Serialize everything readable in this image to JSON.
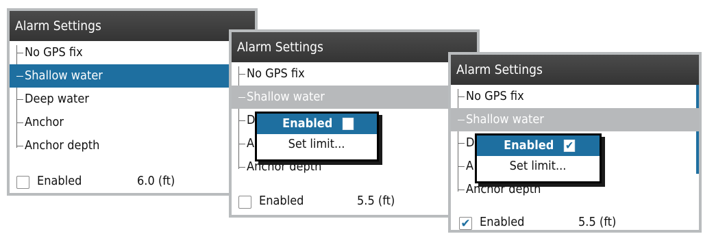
{
  "panels": [
    {
      "title": "Alarm Settings",
      "items": [
        "No GPS fix",
        "Shallow water",
        "Deep water",
        "Anchor",
        "Anchor depth"
      ],
      "selected_index": 1,
      "footer": {
        "checked": false,
        "label": "Enabled",
        "value": "6.0 (ft)"
      }
    },
    {
      "title": "Alarm Settings",
      "items": [
        "No GPS fix",
        "Shallow water",
        "D",
        "A",
        "Anchor depth"
      ],
      "selected_index": 1,
      "popup": {
        "enabled_label": "Enabled",
        "enabled_checked": false,
        "set_limit_label": "Set limit..."
      },
      "footer": {
        "checked": false,
        "label": "Enabled",
        "value": "5.5 (ft)"
      }
    },
    {
      "title": "Alarm Settings",
      "items": [
        "No GPS fix",
        "Shallow water",
        "D",
        "A",
        "Anchor depth"
      ],
      "selected_index": 1,
      "popup": {
        "enabled_label": "Enabled",
        "enabled_checked": true,
        "set_limit_label": "Set limit..."
      },
      "footer": {
        "checked": true,
        "label": "Enabled",
        "value": "5.5 (ft)"
      }
    }
  ],
  "colors": {
    "selected_blue": "#1e6fa0",
    "selected_grey": "#b7b9bb",
    "title_bg": "#3c3c3c"
  }
}
